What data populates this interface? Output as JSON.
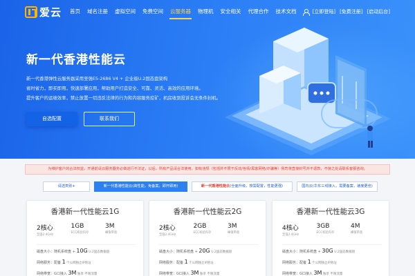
{
  "nav": {
    "logo": "爱云",
    "items": [
      "首页",
      "域名注册",
      "虚拟空间",
      "免费空间",
      "云服务器",
      "物理机",
      "安全相关",
      "代理合作",
      "技术文档"
    ],
    "active_index": 4,
    "links": [
      "[立即登陆]",
      "[免费注册]",
      "[启动后台]"
    ]
  },
  "hero": {
    "title": "新一代香港性能云",
    "desc": [
      "新一代香港弹性云服务器采用至强E5-2686 V4 + 企业级U.2固态盘架构",
      "省时省力，即买即用，快速部署应用，帮助用户打造安全、可靠、灵活、高效的应用环境。",
      "提升客户的运维效率，禁止放置一切违反法律的行为和内容服务挖矿，机房收到投诉会无条件封机。"
    ],
    "btn_primary": "自选配置",
    "btn_secondary": "联系我们"
  },
  "notice": "为维护客户的合法权益，开通前请云服务器务必做进行不法证，以后，所有产品请合法使用，如有违规（包括并不限于反动/色情/黑客网络/诈骗等）我司将直接封号并不退款，不接之处请联系客服咨询。",
  "tabs": [
    {
      "pre": "",
      "hl": "",
      "post": "请选类别+"
    },
    {
      "pre": "",
      "hl": "",
      "post": "新一代香港性能云(高性能，免备案，即开即用)"
    },
    {
      "pre": "",
      "hl": "新一代香港性能云",
      "post": "(全面升级，按需配置，性能更强)"
    },
    {
      "pre": "",
      "hl": "",
      "post": "国内云(华东三线接入，需要备案，速度更佳)"
    }
  ],
  "active_tab": 1,
  "cards": [
    {
      "title": "香港新一代性能云1G",
      "specs": [
        {
          "val": "2核心",
          "lbl": "至强2.4GHz"
        },
        {
          "val": "1GB",
          "lbl": "ECC校验内存"
        },
        {
          "val": "3M",
          "lbl": "峰值带宽"
        }
      ],
      "disk_pre": "磁盘大小：随机系统盘 + ",
      "disk_big": "10G",
      "disk_post": " U.2固态数据盘",
      "ip_pre": "网络服务：配备 ",
      "ip_big": "1",
      "ip_post": " 个公网独立IP地址",
      "bw_pre": "网络带宽：G口接入 ",
      "bw_big": "3M",
      "bw_post": " 独享 不限流量"
    },
    {
      "title": "香港新一代性能云2G",
      "specs": [
        {
          "val": "2核心",
          "lbl": "至强2.4GHz"
        },
        {
          "val": "2GB",
          "lbl": "ECC校验内存"
        },
        {
          "val": "3M",
          "lbl": "峰值带宽"
        }
      ],
      "disk_pre": "磁盘大小：随机系统盘 + ",
      "disk_big": "20G",
      "disk_post": " U.2固态数据盘",
      "ip_pre": "网络服务：配备 ",
      "ip_big": "1",
      "ip_post": " 个公网独立IP地址",
      "bw_pre": "网络带宽：G口接入 ",
      "bw_big": "3M",
      "bw_post": " 独享 不限流量"
    },
    {
      "title": "香港新一代性能云3G",
      "specs": [
        {
          "val": "4核心",
          "lbl": "至强2.4GHz"
        },
        {
          "val": "3GB",
          "lbl": "ECC校验内存"
        },
        {
          "val": "4M",
          "lbl": "峰值带宽"
        }
      ],
      "disk_pre": "磁盘大小：随机系统盘 + ",
      "disk_big": "30G",
      "disk_post": " U.2固态数据盘",
      "ip_pre": "网络服务：配备 ",
      "ip_big": "1",
      "ip_post": " 个公网独立IP地址",
      "bw_pre": "网络带宽：G口接入 ",
      "bw_big": "3M",
      "bw_post": " 独享 不限流量"
    }
  ],
  "colors": {
    "hero_start": "#1a63e8",
    "hero_end": "#3b92fb",
    "accent_yellow": "#ffd44d",
    "notice_red": "#e0463a",
    "tab_blue": "#2e7ff0"
  }
}
